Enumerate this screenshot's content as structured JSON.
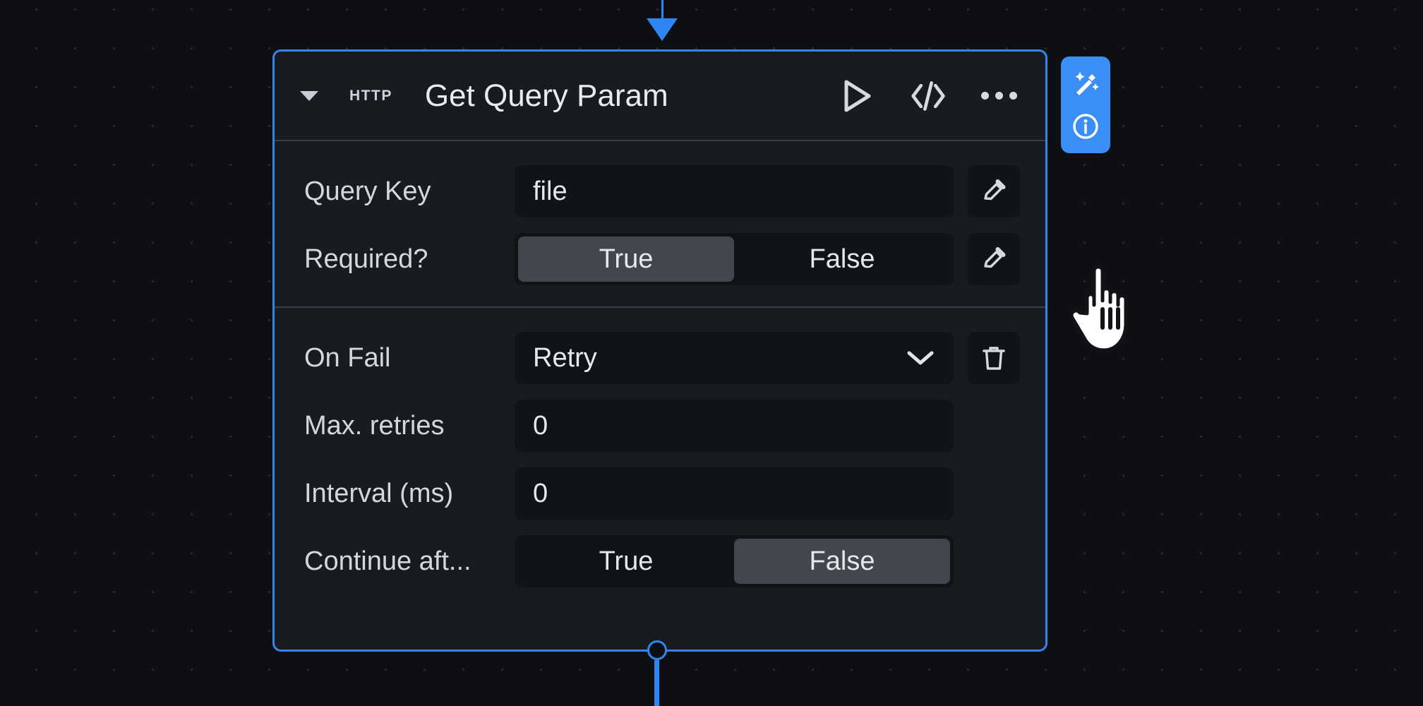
{
  "node": {
    "type_badge": "HTTP",
    "title": "Get Query Param",
    "collapse_caret_icon": "chevron-down",
    "actions": {
      "run_icon": "play-triangle",
      "code_icon": "code-brackets",
      "more_icon": "more-horizontal"
    },
    "params_section": {
      "rows": [
        {
          "label": "Query Key",
          "control": "text",
          "value": "file",
          "edit_icon": "pencil"
        },
        {
          "label": "Required?",
          "control": "toggle",
          "options": [
            "True",
            "False"
          ],
          "selected": "True",
          "edit_icon": "pencil"
        }
      ]
    },
    "error_section": {
      "rows": [
        {
          "label": "On Fail",
          "control": "select",
          "value": "Retry",
          "chevron_icon": "chevron-down",
          "action_icon": "trash"
        },
        {
          "label": "Max. retries",
          "control": "text",
          "value": "0"
        },
        {
          "label": "Interval (ms)",
          "control": "text",
          "value": "0"
        },
        {
          "label": "Continue aft...",
          "control": "toggle",
          "options": [
            "True",
            "False"
          ],
          "selected": "False"
        }
      ]
    }
  },
  "assist_panel": {
    "magic_icon": "magic-wand-sparkles",
    "info_icon": "info-circle",
    "accent_color": "#3b8ef5"
  },
  "canvas": {
    "background_color": "#0d0f13",
    "dot_color": "#262a31",
    "edge_color": "#2f86f0",
    "node_border_color": "#3b82e8",
    "node_background_color": "#181b20",
    "field_background_color": "#101317",
    "toggle_selected_color": "#42464d"
  },
  "cursor": {
    "icon": "pointing-hand-cursor"
  }
}
